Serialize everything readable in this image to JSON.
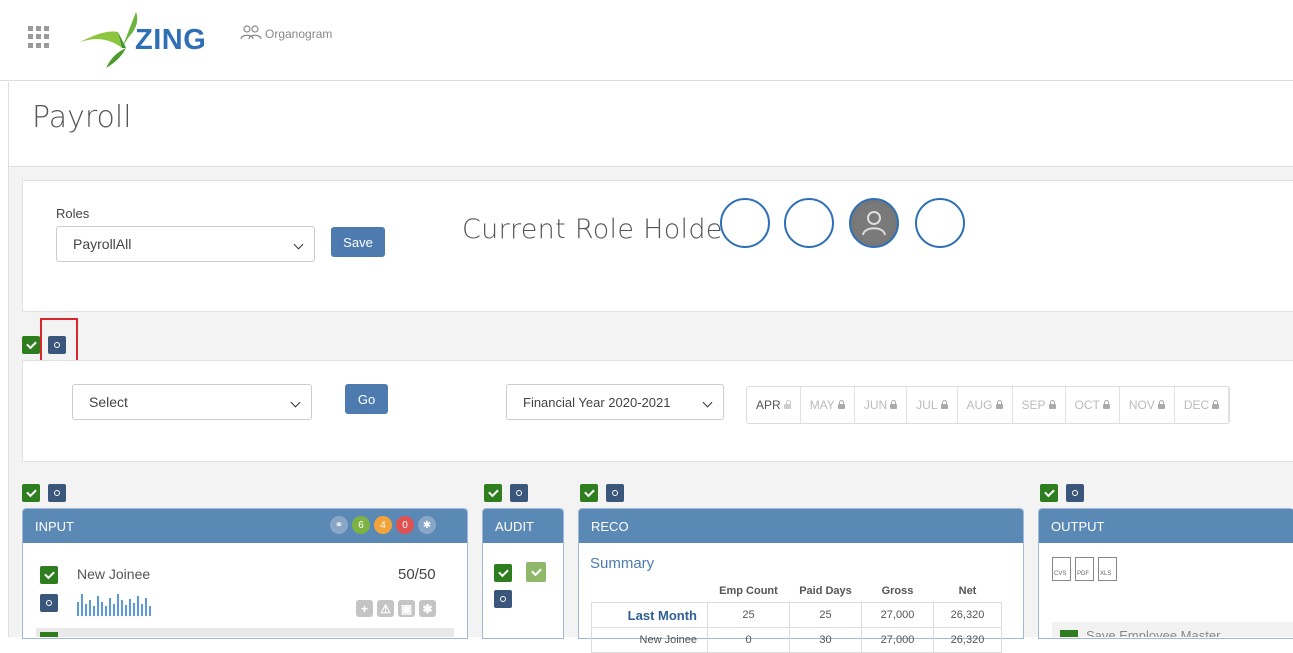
{
  "app": {
    "logo_text": "ZING",
    "organogram_label": "Organogram"
  },
  "page": {
    "title": "Payroll"
  },
  "roles": {
    "label": "Roles",
    "selected": "PayrollAll",
    "save_label": "Save",
    "current_role_holder_label": "Current Role Holder:"
  },
  "filter": {
    "select_value": "Select",
    "go_label": "Go",
    "financial_year": "Financial Year 2020-2021",
    "months": [
      {
        "label": "APR",
        "state": "open"
      },
      {
        "label": "MAY",
        "state": "locked"
      },
      {
        "label": "JUN",
        "state": "locked"
      },
      {
        "label": "JUL",
        "state": "locked"
      },
      {
        "label": "AUG",
        "state": "locked"
      },
      {
        "label": "SEP",
        "state": "locked"
      },
      {
        "label": "OCT",
        "state": "locked"
      },
      {
        "label": "NOV",
        "state": "locked"
      },
      {
        "label": "DEC",
        "state": "locked"
      }
    ]
  },
  "input_panel": {
    "title": "INPUT",
    "badges": [
      {
        "text": "6",
        "color": "#7cb342"
      },
      {
        "text": "4",
        "color": "#f2a43a"
      },
      {
        "text": "0",
        "color": "#e05252"
      }
    ],
    "item_label": "New Joinee",
    "item_count": "50/50"
  },
  "audit_panel": {
    "title": "AUDIT"
  },
  "reco_panel": {
    "title": "RECO",
    "summary_label": "Summary",
    "headers": [
      "Emp Count",
      "Paid Days",
      "Gross",
      "Net"
    ],
    "rows": [
      {
        "label": "Last Month",
        "values": [
          "25",
          "25",
          "27,000",
          "26,320"
        ]
      },
      {
        "label": "New Joinee",
        "values": [
          "0",
          "30",
          "27,000",
          "26,320"
        ]
      }
    ]
  },
  "output_panel": {
    "title": "OUTPUT",
    "files": [
      "CVS",
      "PDF",
      "XLS"
    ],
    "partial_row": "Save Employee Master"
  },
  "colors": {
    "accent": "#5b89b6",
    "green": "#2e7d1e",
    "highlight": "#d9272e"
  }
}
